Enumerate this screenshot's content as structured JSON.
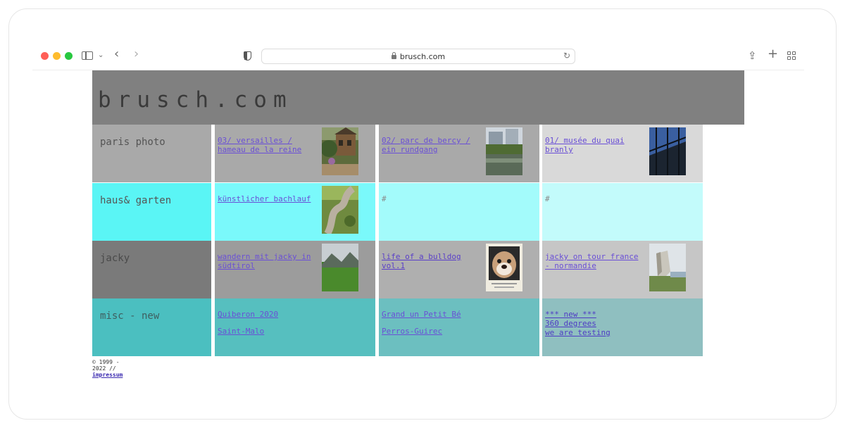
{
  "browser": {
    "url": "brusch.com",
    "icons": [
      "sidebar-icon",
      "chevron-down-icon",
      "back-arrow-icon",
      "forward-arrow-icon",
      "shield-icon",
      "lock-icon",
      "reload-icon",
      "share-icon",
      "plus-icon",
      "tab-overview-icon"
    ]
  },
  "site": {
    "logo": "brusch.com"
  },
  "rows": [
    {
      "label": "paris photo",
      "color": "#a9a9a9",
      "cells": [
        {
          "text": "03/ versailles / hameau de la reine",
          "thumb": "garden-house"
        },
        {
          "text": "02/ parc de bercy / ein rundgang",
          "thumb": "park-pond"
        },
        {
          "text": "01/ musée du quai branly",
          "thumb": "glass-building"
        }
      ]
    },
    {
      "label": "haus& garten",
      "color": "#5af5f5",
      "cells": [
        {
          "text": "künstlicher bachlauf",
          "thumb": "stream"
        },
        {
          "text": "#"
        },
        {
          "text": "#"
        }
      ]
    },
    {
      "label": "jacky",
      "color": "#7a7a7a",
      "cells": [
        {
          "text": "wandern mit jacky in südtirol",
          "thumb": "meadow"
        },
        {
          "text": "life of a bulldog vol.1",
          "thumb": "bulldog"
        },
        {
          "text": "jacky on tour france - normandie",
          "thumb": "cliff"
        }
      ]
    },
    {
      "label": "misc - new",
      "color": "#4bbfc0",
      "cells": [
        {
          "lines": [
            "Quiberon 2020",
            "Saint-Malo"
          ]
        },
        {
          "lines": [
            "Grand un Petit Bé",
            "Perros-Guirec"
          ]
        },
        {
          "lines": [
            "*** new ***",
            "360 degrees",
            "we are testing"
          ]
        }
      ]
    }
  ],
  "footer": {
    "copyright": "© 1999 - 2022 // ",
    "impressum": "impressum"
  }
}
